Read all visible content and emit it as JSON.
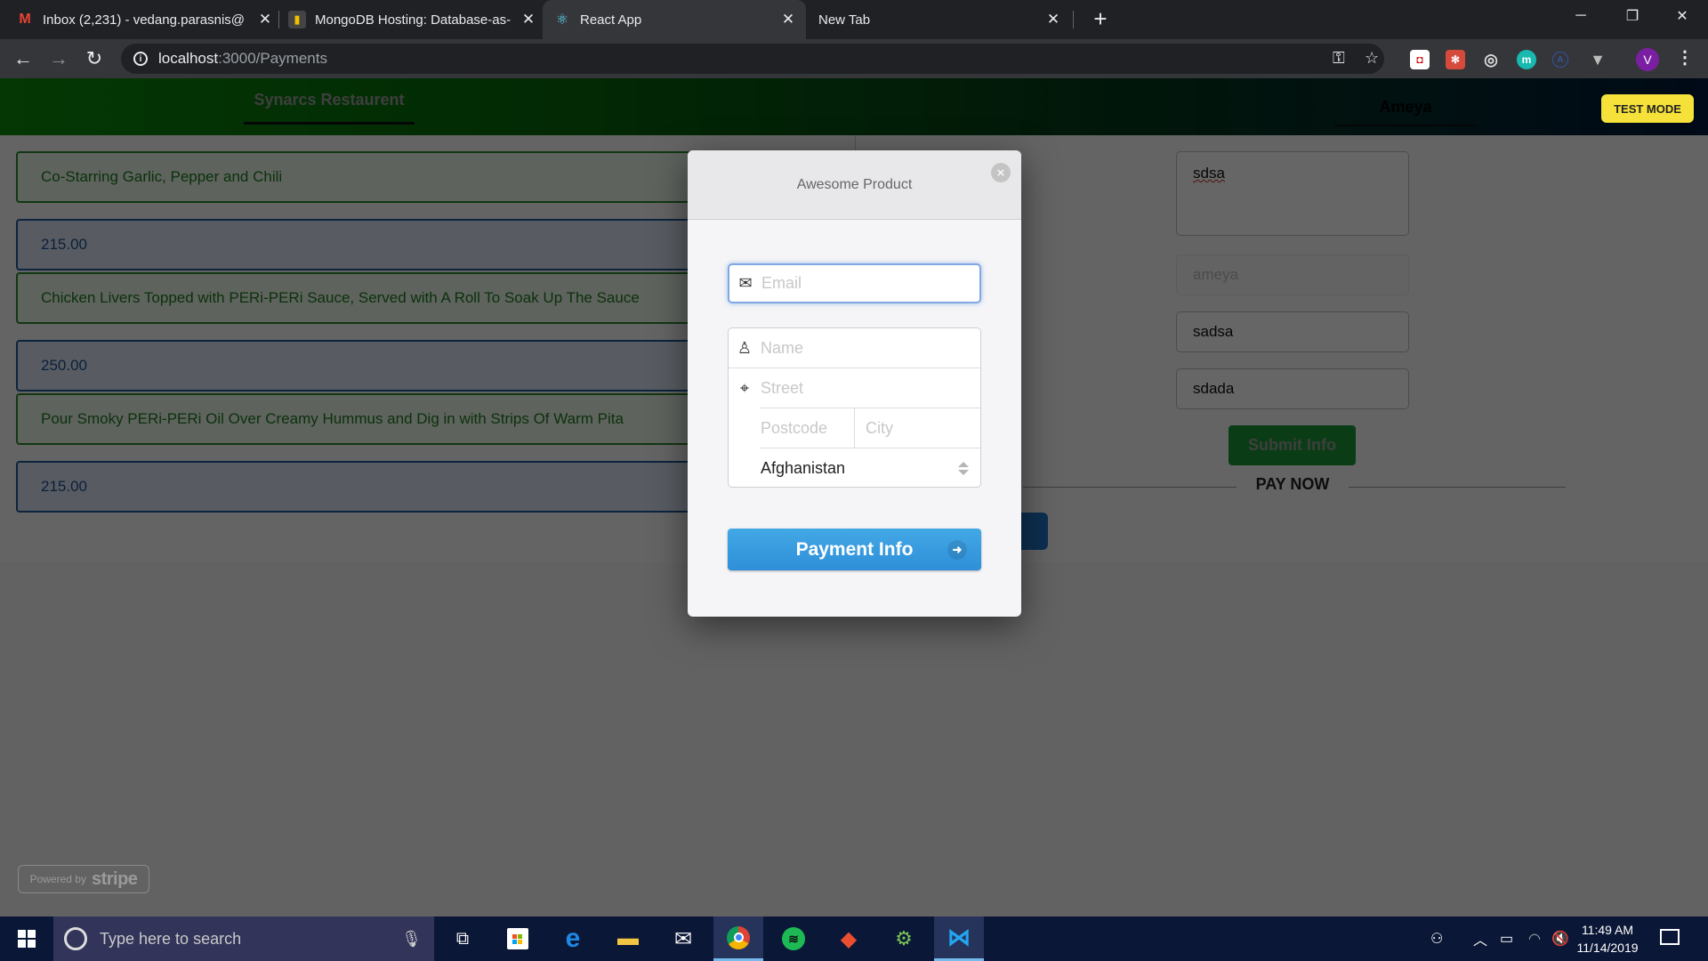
{
  "browser": {
    "tabs": [
      {
        "title": "Inbox (2,231) - vedang.parasnis@",
        "icon": "gmail-icon",
        "active": false
      },
      {
        "title": "MongoDB Hosting: Database-as-",
        "icon": "mongodb-icon",
        "active": false
      },
      {
        "title": "React App",
        "icon": "react-icon",
        "active": true
      },
      {
        "title": "New Tab",
        "icon": "",
        "active": false
      }
    ],
    "close_glyph": "✕",
    "new_tab_glyph": "+",
    "window_controls": {
      "minimize": "─",
      "restore": "❐",
      "close": "✕"
    },
    "url_host": "localhost",
    "url_path": ":3000/Payments",
    "profile_initial": "V",
    "extensions": [
      "mcafee-icon",
      "react-devtools-icon",
      "target-icon",
      "m-extension-icon",
      "a-extension-icon",
      "vue-devtools-icon"
    ]
  },
  "app": {
    "brand": "Synarcs Restaurent",
    "user": "Ameya",
    "test_mode": "TEST MODE",
    "items": [
      {
        "type": "desc",
        "text": "Co-Starring Garlic, Pepper and Chili"
      },
      {
        "type": "price",
        "text": "215.00"
      },
      {
        "type": "desc",
        "text": "Chicken Livers Topped with PERi-PERi Sauce, Served with A Roll To Soak Up The Sauce"
      },
      {
        "type": "price",
        "text": "250.00"
      },
      {
        "type": "desc",
        "text": "Pour Smoky PERi-PERi Oil Over Creamy Hummus and Dig in with Strips Of Warm Pita"
      },
      {
        "type": "price",
        "text": "215.00"
      }
    ],
    "form": {
      "address_value": "sdsa",
      "name_placeholder": "ameya",
      "field2_value": "sadsa",
      "field3_value": "sdada",
      "submit_label": "Submit Info",
      "pay_now_label": "PAY NOW"
    }
  },
  "stripe": {
    "powered_by": "Powered by",
    "brand": "stripe"
  },
  "checkout": {
    "title": "Awesome Product",
    "email_placeholder": "Email",
    "name_placeholder": "Name",
    "street_placeholder": "Street",
    "postcode_placeholder": "Postcode",
    "city_placeholder": "City",
    "country_value": "Afghanistan",
    "submit_label": "Payment Info"
  },
  "taskbar": {
    "search_placeholder": "Type here to search",
    "time": "11:49 AM",
    "date": "11/14/2019",
    "pinned": [
      "task-view-icon",
      "store-icon",
      "edge-icon",
      "file-explorer-icon",
      "mail-icon",
      "chrome-icon",
      "spotify-icon",
      "git-icon",
      "android-studio-icon",
      "vscode-icon"
    ]
  }
}
